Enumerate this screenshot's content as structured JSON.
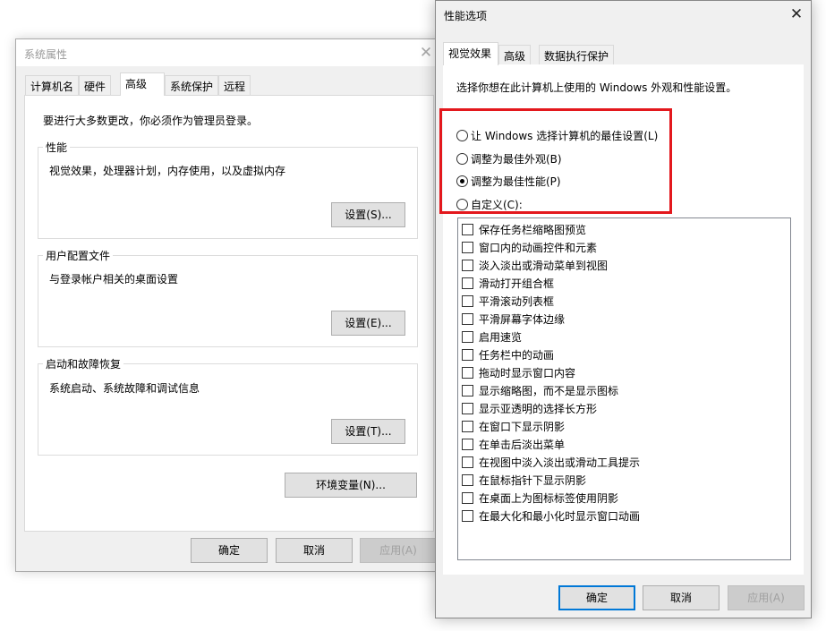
{
  "system_properties": {
    "title": "系统属性",
    "close_glyph": "✕",
    "tabs": [
      "计算机名",
      "硬件",
      "高级",
      "系统保护",
      "远程"
    ],
    "admin_notice": "要进行大多数更改，你必须作为管理员登录。",
    "performance": {
      "label": "性能",
      "description": "视觉效果，处理器计划，内存使用，以及虚拟内存",
      "button": "设置(S)..."
    },
    "user_profiles": {
      "label": "用户配置文件",
      "description": "与登录帐户相关的桌面设置",
      "button": "设置(E)..."
    },
    "startup_recovery": {
      "label": "启动和故障恢复",
      "description": "系统启动、系统故障和调试信息",
      "button": "设置(T)..."
    },
    "env_button": "环境变量(N)...",
    "ok": "确定",
    "cancel": "取消",
    "apply": "应用(A)"
  },
  "performance_options": {
    "title": "性能选项",
    "close_glyph": "✕",
    "tabs": [
      "视觉效果",
      "高级",
      "数据执行保护"
    ],
    "intro": "选择你想在此计算机上使用的 Windows 外观和性能设置。",
    "radios": [
      {
        "label": "让 Windows 选择计算机的最佳设置(L)",
        "checked": false
      },
      {
        "label": "调整为最佳外观(B)",
        "checked": false
      },
      {
        "label": "调整为最佳性能(P)",
        "checked": true
      },
      {
        "label": "自定义(C):",
        "checked": false
      }
    ],
    "highlight_color": "#e3181d",
    "checkboxes": [
      "保存任务栏缩略图预览",
      "窗口内的动画控件和元素",
      "淡入淡出或滑动菜单到视图",
      "滑动打开组合框",
      "平滑滚动列表框",
      "平滑屏幕字体边缘",
      "启用速览",
      "任务栏中的动画",
      "拖动时显示窗口内容",
      "显示缩略图，而不是显示图标",
      "显示亚透明的选择长方形",
      "在窗口下显示阴影",
      "在单击后淡出菜单",
      "在视图中淡入淡出或滑动工具提示",
      "在鼠标指针下显示阴影",
      "在桌面上为图标标签使用阴影",
      "在最大化和最小化时显示窗口动画"
    ],
    "ok": "确定",
    "cancel": "取消",
    "apply": "应用(A)"
  }
}
